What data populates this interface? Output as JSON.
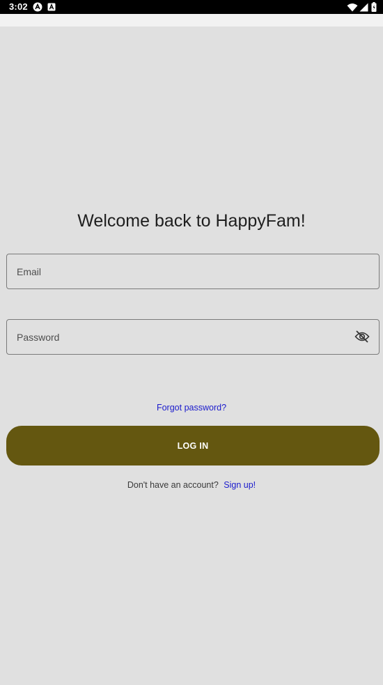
{
  "status_bar": {
    "time": "3:02",
    "icons": [
      "android-notification-icon",
      "font-notification-icon",
      "wifi-icon",
      "signal-icon",
      "battery-icon"
    ]
  },
  "login": {
    "title": "Welcome back to HappyFam!",
    "email_placeholder": "Email",
    "password_placeholder": "Password",
    "forgot_password": "Forgot password?",
    "login_button": "LOG IN",
    "signup_prompt": "Don't have an account?",
    "signup_link": "Sign up!"
  },
  "colors": {
    "background": "#e0e0e0",
    "primary_button": "#645710",
    "link": "#1a1acc"
  }
}
